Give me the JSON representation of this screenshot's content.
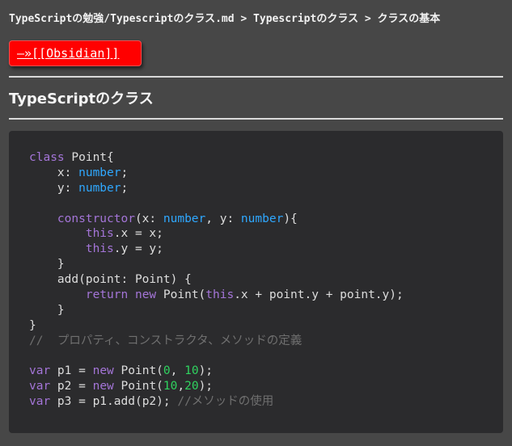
{
  "breadcrumb": "TypeScriptの勉強/Typescriptのクラス.md > Typescriptのクラス > クラスの基本",
  "obsidian_link": "—»[[Obsidian]]",
  "section_title": "TypeScriptのクラス",
  "colors": {
    "background": "#474747",
    "link_button": "#ff0000",
    "code_background": "#2b2b2d",
    "keyword": "#a475d8",
    "type": "#2fa8ff",
    "number": "#2fd35f",
    "comment": "#6f6f6f",
    "text": "#dddddd"
  },
  "code_lines": [
    [
      {
        "t": "kw",
        "v": "class"
      },
      {
        "t": "plain",
        "v": " Point{"
      }
    ],
    [
      {
        "t": "plain",
        "v": "    x: "
      },
      {
        "t": "type",
        "v": "number"
      },
      {
        "t": "plain",
        "v": ";"
      }
    ],
    [
      {
        "t": "plain",
        "v": "    y: "
      },
      {
        "t": "type",
        "v": "number"
      },
      {
        "t": "plain",
        "v": ";"
      }
    ],
    [],
    [
      {
        "t": "plain",
        "v": "    "
      },
      {
        "t": "kw",
        "v": "constructor"
      },
      {
        "t": "plain",
        "v": "(x: "
      },
      {
        "t": "type",
        "v": "number"
      },
      {
        "t": "plain",
        "v": ", y: "
      },
      {
        "t": "type",
        "v": "number"
      },
      {
        "t": "plain",
        "v": "){"
      }
    ],
    [
      {
        "t": "plain",
        "v": "        "
      },
      {
        "t": "kw",
        "v": "this"
      },
      {
        "t": "plain",
        "v": ".x = x;"
      }
    ],
    [
      {
        "t": "plain",
        "v": "        "
      },
      {
        "t": "kw",
        "v": "this"
      },
      {
        "t": "plain",
        "v": ".y = y;"
      }
    ],
    [
      {
        "t": "plain",
        "v": "    }"
      }
    ],
    [
      {
        "t": "plain",
        "v": "    add(point: Point) {"
      }
    ],
    [
      {
        "t": "plain",
        "v": "        "
      },
      {
        "t": "kw",
        "v": "return"
      },
      {
        "t": "plain",
        "v": " "
      },
      {
        "t": "kw",
        "v": "new"
      },
      {
        "t": "plain",
        "v": " Point("
      },
      {
        "t": "kw",
        "v": "this"
      },
      {
        "t": "plain",
        "v": ".x + point.y + point.y);"
      }
    ],
    [
      {
        "t": "plain",
        "v": "    }"
      }
    ],
    [
      {
        "t": "plain",
        "v": "}"
      }
    ],
    [
      {
        "t": "cmt",
        "v": "//  プロパティ、コンストラクタ、メソッドの定義"
      }
    ],
    [],
    [
      {
        "t": "kw",
        "v": "var"
      },
      {
        "t": "plain",
        "v": " p1 = "
      },
      {
        "t": "kw",
        "v": "new"
      },
      {
        "t": "plain",
        "v": " Point("
      },
      {
        "t": "num",
        "v": "0"
      },
      {
        "t": "plain",
        "v": ", "
      },
      {
        "t": "num",
        "v": "10"
      },
      {
        "t": "plain",
        "v": ");"
      }
    ],
    [
      {
        "t": "kw",
        "v": "var"
      },
      {
        "t": "plain",
        "v": " p2 = "
      },
      {
        "t": "kw",
        "v": "new"
      },
      {
        "t": "plain",
        "v": " Point("
      },
      {
        "t": "num",
        "v": "10"
      },
      {
        "t": "plain",
        "v": ","
      },
      {
        "t": "num",
        "v": "20"
      },
      {
        "t": "plain",
        "v": ");"
      }
    ],
    [
      {
        "t": "kw",
        "v": "var"
      },
      {
        "t": "plain",
        "v": " p3 = p1.add(p2); "
      },
      {
        "t": "cmt",
        "v": "//メソッドの使用"
      }
    ]
  ]
}
